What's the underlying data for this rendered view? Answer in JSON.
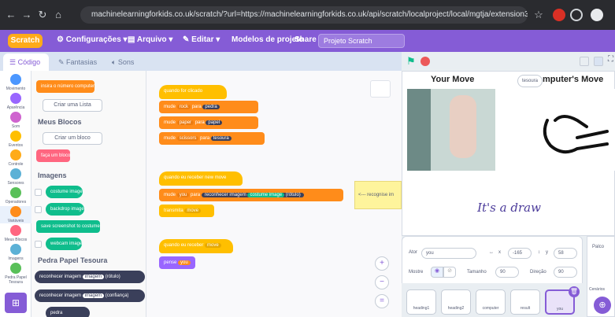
{
  "browser": {
    "url": "machinelearningforkids.co.uk/scratch/?url=https://machinelearningforkids.co.uk/api/scratch/localproject/local/mgtja/extension3.js%2Fproject%2Fmodel%2Fd4..."
  },
  "menubar": {
    "logo": "Scratch",
    "settings": "Configurações",
    "file": "Arquivo",
    "edit": "Editar",
    "templates": "Modelos de projeto",
    "share": "Share",
    "project_title": "Projeto Scratch"
  },
  "tabs": {
    "code": "Código",
    "costumes": "Fantasias",
    "sounds": "Sons"
  },
  "categories": [
    {
      "label": "Movimento",
      "color": "#4c97ff"
    },
    {
      "label": "Aparência",
      "color": "#9966ff"
    },
    {
      "label": "Som",
      "color": "#cf63cf"
    },
    {
      "label": "Eventos",
      "color": "#ffbf00"
    },
    {
      "label": "Controle",
      "color": "#ffab19"
    },
    {
      "label": "Sensores",
      "color": "#5cb1d6"
    },
    {
      "label": "Operadores",
      "color": "#59c059"
    },
    {
      "label": "Variáveis",
      "color": "#ff8c1a"
    },
    {
      "label": "Meus Blocos",
      "color": "#ff6680"
    },
    {
      "label": "Imagens",
      "color": "#5cb1d6"
    },
    {
      "label": "Pedra Papel Tesoura",
      "color": "#59c059"
    }
  ],
  "palette": {
    "top_block": "insira o número computer",
    "create_list": "Criar uma Lista",
    "my_blocks_head": "Meus Blocos",
    "create_block": "Criar um bloco",
    "make_a_block": "faça um bloco",
    "images_head": "Imagens",
    "images_blocks": [
      "costume image",
      "backdrop image",
      "save screenshot to costume",
      "webcam image"
    ],
    "rps_head": "Pedra Papel Tesoura",
    "rps_blocks": [
      "reconhecer imagem",
      "reconhecer imagem",
      "pedra"
    ],
    "rps_tag": "imagem",
    "rps_tag2": "(rótulo)",
    "rps_tag3": "(confiança)"
  },
  "workspace": {
    "script1": {
      "hat": "quando for clicado",
      "lines": [
        {
          "a": "mude",
          "b": "rock",
          "c": "para",
          "d": "pedra"
        },
        {
          "a": "mude",
          "b": "paper",
          "c": "para",
          "d": "papel"
        },
        {
          "a": "mude",
          "b": "scissors",
          "c": "para",
          "d": "tesoura"
        }
      ]
    },
    "script2": {
      "hat": "quando eu receber new move",
      "line1_a": "mude",
      "line1_b": "you",
      "line1_c": "para",
      "line1_d": "reconhecer imagem",
      "line1_e": "costume image",
      "line1_f": "(rótulo)",
      "line2": "transmita",
      "line2_b": "move",
      "comment": "<--- recognise im"
    },
    "script3": {
      "hat": "quando eu receber",
      "hat_b": "move",
      "line1": "pense",
      "line1_b": "you"
    }
  },
  "stage": {
    "your_move": "Your Move",
    "tooltip": "tesoura",
    "computer_move": "mputer's Move",
    "result": "It's a draw"
  },
  "sprite_info": {
    "sprite_label": "Ator",
    "sprite_name": "you",
    "x_label": "x",
    "x_value": "-165",
    "y_label": "y",
    "y_value": "58",
    "show_label": "Mostre",
    "size_label": "Tamanho",
    "size_value": "90",
    "direction_label": "Direção",
    "direction_value": "90",
    "sprites": [
      "heading1",
      "heading2",
      "computer",
      "result",
      "you"
    ]
  },
  "stagebar": {
    "label": "Palco",
    "label2": "Cenários"
  },
  "colors": {
    "scratch_purple": "#855cd6",
    "events": "#ffbf00",
    "control": "#ffab19",
    "variables": "#ff8c1a",
    "looks": "#9966ff",
    "ml_green": "#59c059",
    "ml_dark": "#3a3f5a",
    "images_teal": "#0fbd8c"
  }
}
